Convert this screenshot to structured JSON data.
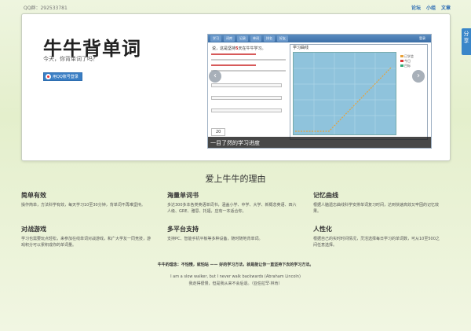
{
  "topbar": {
    "qq_group": "QQ群：292533781",
    "links": [
      "论坛",
      "小组",
      "文章"
    ]
  },
  "share_tab": "分享",
  "hero": {
    "title": "牛牛背单词",
    "subtitle": "今天，你背单词了吗？",
    "qq_login_label": "用QQ账号登录",
    "screenshot": {
      "nav_tabs": [
        "学习",
        "词库",
        "记录",
        "单词",
        "排名",
        "好友"
      ],
      "login_label": "登录",
      "greeting_prefix": "说，这是坚持",
      "greeting_number": "5",
      "greeting_suffix": "天在牛牛学习。",
      "count_value": "20",
      "chart_title": "学习曲线",
      "legend": [
        {
          "label": "已学会",
          "color": "#e8a23a"
        },
        {
          "label": "今日",
          "color": "#d33"
        },
        {
          "label": "目标",
          "color": "#3a7"
        }
      ],
      "caption": "一目了然的学习进度"
    },
    "arrow_prev": "‹",
    "arrow_next": "›"
  },
  "reasons": {
    "title": "爱上牛牛的理由",
    "features": [
      {
        "title": "简单有效",
        "text": "操作简单，方法科学有效，每天学习10至30分钟，背单词不再难坚持。"
      },
      {
        "title": "海量单词书",
        "text": "多达300多本各类英语单词书，涵盖小学、中学、大学、新概念英语、四六人级、GRE、雅思、托福，应有一本适合你。"
      },
      {
        "title": "记忆曲线",
        "text": "根据人脑遗忘曲线科学安排单词复习时间，达到快速高效又牢固的记忆效果。"
      },
      {
        "title": "对战游戏",
        "text": "学习也需要玩点轻松，来参加在线单词对战游戏，和广大学友一同竞技，游戏积分可以累积成你的单词量。"
      },
      {
        "title": "多平台支持",
        "text": "支持PC、智能手机平板等多种设备，随时随地背单词。"
      },
      {
        "title": "人性化",
        "text": "根据自己的实时时间情况，灵活选择每日学习的单词数，可从10至500之间任意选择。"
      }
    ]
  },
  "philosophy": "牛牛的理念：不怕慢，就怕站 —— 好的学习方法，就是能让你一直坚持下去的学习方法。",
  "quote_en": "I am a slow walker, but I never walk backwards (Abraham Lincoln)",
  "quote_zh": "我走得很慢，但是我从来不会后退。（亚伯拉罕·林肯）"
}
